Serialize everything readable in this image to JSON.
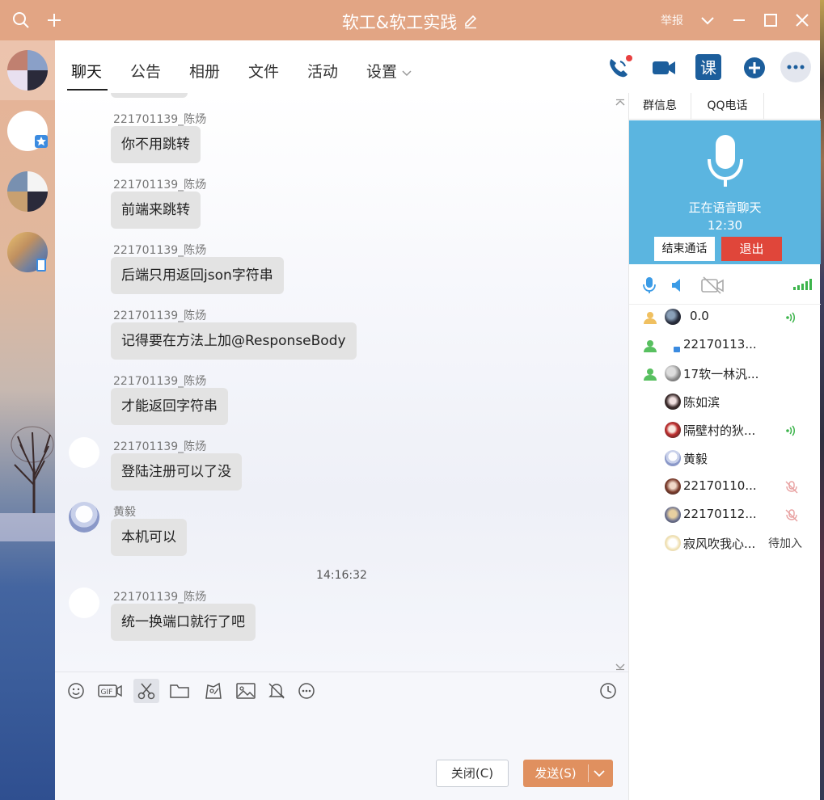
{
  "window": {
    "title": "软工&软工实践",
    "report_label": "举报"
  },
  "tabs": [
    {
      "label": "聊天"
    },
    {
      "label": "公告"
    },
    {
      "label": "相册"
    },
    {
      "label": "文件"
    },
    {
      "label": "活动"
    },
    {
      "label": "设置"
    }
  ],
  "header_buttons": {
    "course_label": "课"
  },
  "messages": [
    {
      "sender": "221701139_陈炀",
      "text": "你不用跳转"
    },
    {
      "sender": "221701139_陈炀",
      "text": "前端来跳转"
    },
    {
      "sender": "221701139_陈炀",
      "text": "后端只用返回json字符串"
    },
    {
      "sender": "221701139_陈炀",
      "text": "记得要在方法上加@ResponseBody"
    },
    {
      "sender": "221701139_陈炀",
      "text": "才能返回字符串"
    },
    {
      "sender": "221701139_陈炀",
      "text": "登陆注册可以了没"
    },
    {
      "sender": "黄毅",
      "text": "本机可以"
    },
    {
      "sender": "221701139_陈炀",
      "text": "统一换端口就行了吧"
    }
  ],
  "timestamp": "14:16:32",
  "composer": {
    "close_label": "关闭(C)",
    "send_label": "发送(S)"
  },
  "right_panel": {
    "tabs": [
      {
        "label": "群信息"
      },
      {
        "label": "QQ电话"
      }
    ],
    "voice_status": "正在语音聊天",
    "voice_time": "12:30",
    "end_call_label": "结束通话",
    "quit_label": "退出",
    "members": [
      {
        "name": "0.0",
        "status": "speaking"
      },
      {
        "name": "22170113...",
        "status": ""
      },
      {
        "name": "17软一林汎...",
        "status": ""
      },
      {
        "name": "陈如滨",
        "status": ""
      },
      {
        "name": "隔壁村的狄...",
        "status": "speaking"
      },
      {
        "name": "黄毅",
        "status": ""
      },
      {
        "name": "22170110...",
        "status": "muted"
      },
      {
        "name": "22170112...",
        "status": "muted"
      },
      {
        "name": "寂风吹我心...",
        "status": "waiting",
        "wait_label": "待加入"
      }
    ]
  },
  "colors": {
    "titlebar": "#e2a584",
    "send_button": "#e0905f",
    "voice_panel": "#5bb5e0",
    "quit_button": "#e0463a"
  }
}
